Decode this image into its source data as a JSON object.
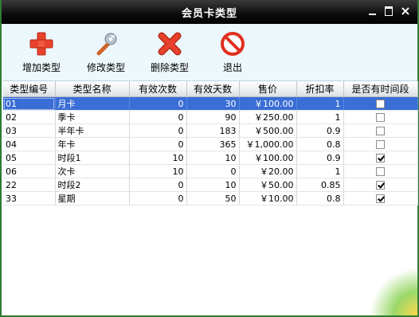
{
  "window": {
    "title": "会员卡类型"
  },
  "toolbar": {
    "add_label": "增加类型",
    "edit_label": "修改类型",
    "delete_label": "删除类型",
    "exit_label": "退出"
  },
  "table": {
    "columns": [
      "类型编号",
      "类型名称",
      "有效次数",
      "有效天数",
      "售价",
      "折扣率",
      "是否有时间段"
    ],
    "rows": [
      {
        "code": "01",
        "name": "月卡",
        "times": "0",
        "days": "30",
        "price": "￥100.00",
        "discount": "1",
        "has_period": false,
        "selected": true
      },
      {
        "code": "02",
        "name": "季卡",
        "times": "0",
        "days": "90",
        "price": "￥250.00",
        "discount": "1",
        "has_period": false
      },
      {
        "code": "03",
        "name": "半年卡",
        "times": "0",
        "days": "183",
        "price": "￥500.00",
        "discount": "0.9",
        "has_period": false
      },
      {
        "code": "04",
        "name": "年卡",
        "times": "0",
        "days": "365",
        "price": "￥1,000.00",
        "discount": "0.8",
        "has_period": false
      },
      {
        "code": "05",
        "name": "时段1",
        "times": "10",
        "days": "10",
        "price": "￥100.00",
        "discount": "0.9",
        "has_period": true
      },
      {
        "code": "06",
        "name": "次卡",
        "times": "10",
        "days": "0",
        "price": "￥20.00",
        "discount": "1",
        "has_period": false
      },
      {
        "code": "22",
        "name": "时段2",
        "times": "0",
        "days": "10",
        "price": "￥50.00",
        "discount": "0.85",
        "has_period": true
      },
      {
        "code": "33",
        "name": "星期",
        "times": "0",
        "days": "50",
        "price": "￥10.00",
        "discount": "0.8",
        "has_period": true
      }
    ]
  },
  "colors": {
    "selection": "#3a6ed6",
    "titlebar": "#000000",
    "add_icon": "#e8412c",
    "delete_icon": "#e0301e"
  }
}
